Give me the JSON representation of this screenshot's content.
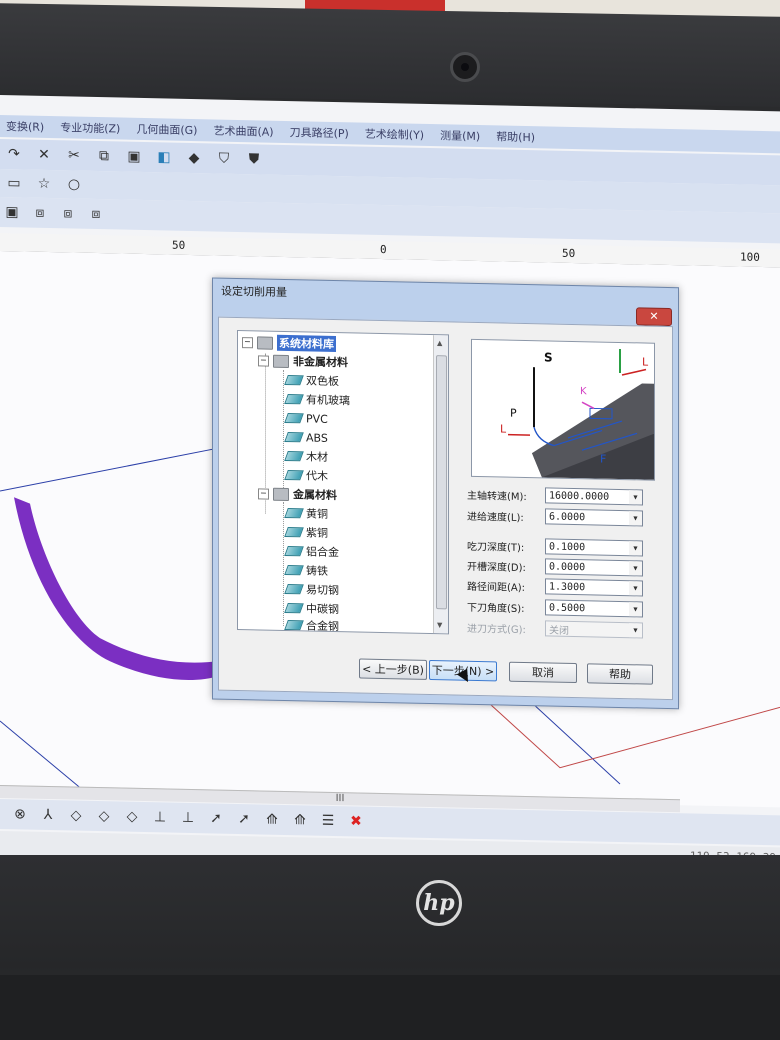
{
  "menubar": {
    "items": [
      "变换(R)",
      "专业功能(Z)",
      "几何曲面(G)",
      "艺术曲面(A)",
      "刀具路径(P)",
      "艺术绘制(Y)",
      "测量(M)",
      "帮助(H)"
    ]
  },
  "ruler": {
    "ticks": [
      "50",
      "0",
      "50",
      "100"
    ]
  },
  "dialog": {
    "title": "设定切削用量",
    "close_label": "✕",
    "tree": {
      "root": "系统材料库",
      "groups": [
        {
          "label": "非金属材料",
          "items": [
            "双色板",
            "有机玻璃",
            "PVC",
            "ABS",
            "木材",
            "代木"
          ]
        },
        {
          "label": "金属材料",
          "items": [
            "黄铜",
            "紫铜",
            "铝合金",
            "铸铁",
            "易切钢",
            "中碳钢",
            "合金钢"
          ]
        }
      ]
    },
    "preview": {
      "labels": [
        "S",
        "P",
        "L",
        "K",
        "L",
        "F"
      ]
    },
    "params": [
      {
        "label": "主轴转速(M):",
        "value": "16000.0000"
      },
      {
        "label": "进给速度(L):",
        "value": "6.0000"
      },
      {
        "label": "吃刀深度(T):",
        "value": "0.1000"
      },
      {
        "label": "开槽深度(D):",
        "value": "0.0000"
      },
      {
        "label": "路径间距(A):",
        "value": "1.3000"
      },
      {
        "label": "下刀角度(S):",
        "value": "0.5000"
      },
      {
        "label": "进刀方式(G):",
        "value": "关闭"
      }
    ],
    "buttons": {
      "back": "< 上一步(B)",
      "next": "下一步(N) >",
      "cancel": "取消",
      "help": "帮助"
    }
  },
  "hscroll_label": "III",
  "status": {
    "coords": "119.53 169.39"
  },
  "laptop": {
    "brand": "hp"
  }
}
